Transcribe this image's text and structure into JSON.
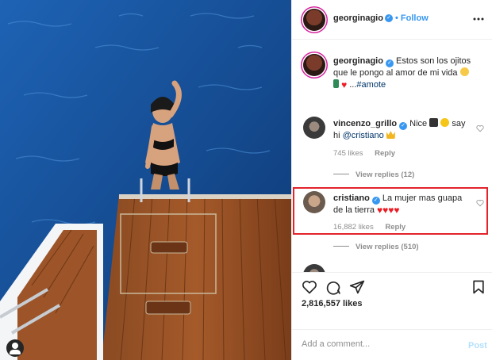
{
  "post": {
    "author": "georginagio",
    "follow_label": "Follow",
    "separator": "•",
    "caption_user": "georginagio",
    "caption_line1": "Estos son los ojitos",
    "caption_line2": "que le pongo al amor de mi vida",
    "caption_ellipsis": "...",
    "caption_hashtag": "#amote"
  },
  "comments": [
    {
      "user": "vincenzo_grillo",
      "text_a": "Nice",
      "text_b": "say",
      "text_c": "hi",
      "mention": "@cristiano",
      "likes": "745 likes",
      "reply_label": "Reply",
      "view_replies": "View replies (12)"
    },
    {
      "user": "cristiano",
      "text_a": "La mujer mas guapa",
      "text_b": "de la tierra",
      "likes": "16,882 likes",
      "reply_label": "Reply",
      "view_replies": "View replies (510)"
    }
  ],
  "actions": {
    "likes": "2,816,557 likes"
  },
  "composer": {
    "placeholder": "Add a comment...",
    "post_label": "Post"
  },
  "colors": {
    "accent": "#3897f0",
    "highlight": "#e3232b",
    "heart": "#ed1c24"
  }
}
